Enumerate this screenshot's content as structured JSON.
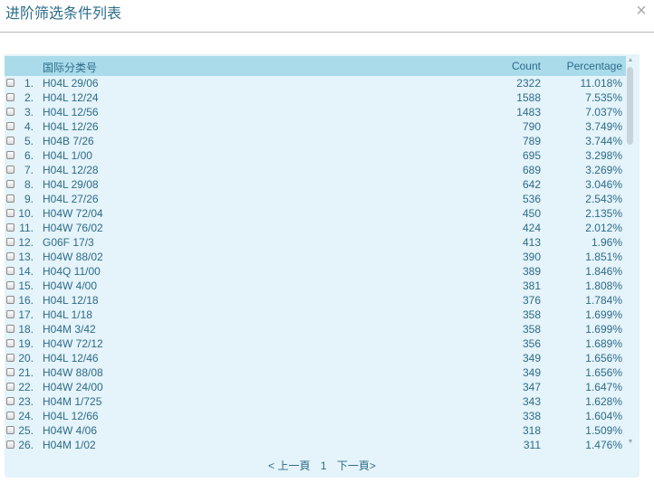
{
  "dialog": {
    "title": "进阶筛选条件列表",
    "close_label": "×"
  },
  "table": {
    "headers": {
      "code": "国际分类号",
      "count": "Count",
      "percentage": "Percentage"
    },
    "rows": [
      {
        "index": "1.",
        "code": "H04L 29/06",
        "count": "2322",
        "percentage": "11.018%"
      },
      {
        "index": "2.",
        "code": "H04L 12/24",
        "count": "1588",
        "percentage": "7.535%"
      },
      {
        "index": "3.",
        "code": "H04L 12/56",
        "count": "1483",
        "percentage": "7.037%"
      },
      {
        "index": "4.",
        "code": "H04L 12/26",
        "count": "790",
        "percentage": "3.749%"
      },
      {
        "index": "5.",
        "code": "H04B 7/26",
        "count": "789",
        "percentage": "3.744%"
      },
      {
        "index": "6.",
        "code": "H04L 1/00",
        "count": "695",
        "percentage": "3.298%"
      },
      {
        "index": "7.",
        "code": "H04L 12/28",
        "count": "689",
        "percentage": "3.269%"
      },
      {
        "index": "8.",
        "code": "H04L 29/08",
        "count": "642",
        "percentage": "3.046%"
      },
      {
        "index": "9.",
        "code": "H04L 27/26",
        "count": "536",
        "percentage": "2.543%"
      },
      {
        "index": "10.",
        "code": "H04W 72/04",
        "count": "450",
        "percentage": "2.135%"
      },
      {
        "index": "11.",
        "code": "H04W 76/02",
        "count": "424",
        "percentage": "2.012%"
      },
      {
        "index": "12.",
        "code": "G06F 17/3",
        "count": "413",
        "percentage": "1.96%"
      },
      {
        "index": "13.",
        "code": "H04W 88/02",
        "count": "390",
        "percentage": "1.851%"
      },
      {
        "index": "14.",
        "code": "H04Q 11/00",
        "count": "389",
        "percentage": "1.846%"
      },
      {
        "index": "15.",
        "code": "H04W 4/00",
        "count": "381",
        "percentage": "1.808%"
      },
      {
        "index": "16.",
        "code": "H04L 12/18",
        "count": "376",
        "percentage": "1.784%"
      },
      {
        "index": "17.",
        "code": "H04L 1/18",
        "count": "358",
        "percentage": "1.699%"
      },
      {
        "index": "18.",
        "code": "H04M 3/42",
        "count": "358",
        "percentage": "1.699%"
      },
      {
        "index": "19.",
        "code": "H04W 72/12",
        "count": "356",
        "percentage": "1.689%"
      },
      {
        "index": "20.",
        "code": "H04L 12/46",
        "count": "349",
        "percentage": "1.656%"
      },
      {
        "index": "21.",
        "code": "H04W 88/08",
        "count": "349",
        "percentage": "1.656%"
      },
      {
        "index": "22.",
        "code": "H04W 24/00",
        "count": "347",
        "percentage": "1.647%"
      },
      {
        "index": "23.",
        "code": "H04M 1/725",
        "count": "343",
        "percentage": "1.628%"
      },
      {
        "index": "24.",
        "code": "H04L 12/66",
        "count": "338",
        "percentage": "1.604%"
      },
      {
        "index": "25.",
        "code": "H04W 4/06",
        "count": "318",
        "percentage": "1.509%"
      },
      {
        "index": "26.",
        "code": "H04M 1/02",
        "count": "311",
        "percentage": "1.476%"
      }
    ]
  },
  "scrollbar": {
    "up_icon": "arrow-up-icon",
    "down_icon": "arrow-down-icon"
  },
  "pager": {
    "prev_label": "< 上一頁",
    "current_page": "1",
    "next_label": "下一頁>"
  }
}
